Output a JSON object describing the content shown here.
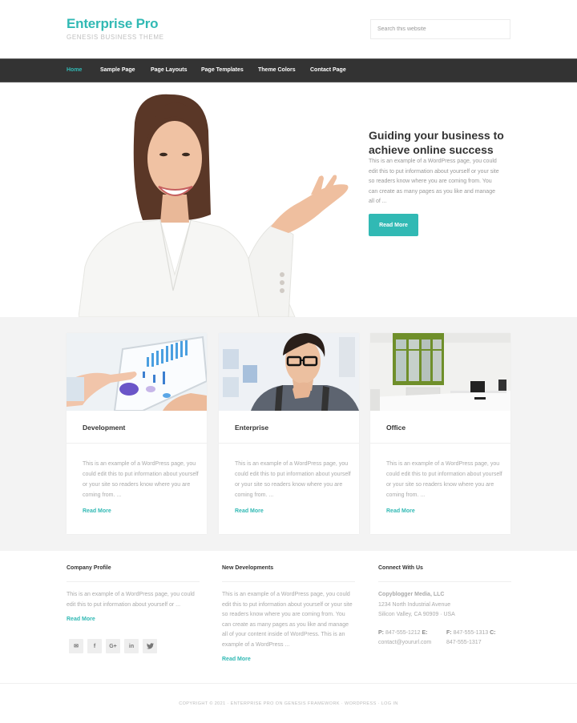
{
  "header": {
    "site_title": "Enterprise Pro",
    "site_description": "GENESIS BUSINESS THEME",
    "search_placeholder": "Search this website"
  },
  "nav": {
    "items": [
      {
        "label": "Home",
        "active": true
      },
      {
        "label": "Sample Page",
        "active": false
      },
      {
        "label": "Page Layouts",
        "active": false
      },
      {
        "label": "Page Templates",
        "active": false
      },
      {
        "label": "Theme Colors",
        "active": false
      },
      {
        "label": "Contact Page",
        "active": false
      }
    ]
  },
  "hero": {
    "image_alt": "Smiling businesswoman in white blazer presenting with open hand",
    "title": "Guiding your business to achieve online success",
    "text": "This is an example of a WordPress page, you could edit this to put information about yourself or your site so readers know where you are coming from. You can create as many pages as you like and manage all of ...",
    "button_label": "Read More"
  },
  "features": {
    "cards": [
      {
        "title": "Development",
        "image_alt": "Hand pointing at charts on a tablet",
        "text": "This is an example of a WordPress page, you could edit this to put information about yourself or your site so readers know where you are coming from. ...",
        "link_label": "Read More"
      },
      {
        "title": "Enterprise",
        "image_alt": "Man with glasses, hand on chin",
        "text": "This is an example of a WordPress page, you could edit this to put information about yourself or your site so readers know where you are coming from. ...",
        "link_label": "Read More"
      },
      {
        "title": "Office",
        "image_alt": "Bright office with green-framed windows and computers",
        "text": "This is an example of a WordPress page, you could edit this to put information about yourself or your site so readers know where you are coming from. ...",
        "link_label": "Read More"
      }
    ]
  },
  "widgets": {
    "company_profile": {
      "title": "Company Profile",
      "text": "This is an example of a WordPress page, you could edit this to put information about yourself or ...",
      "link_label": "Read More",
      "social": [
        {
          "icon": "envelope-icon",
          "glyph": "✉"
        },
        {
          "icon": "facebook-icon",
          "glyph": "f"
        },
        {
          "icon": "google-plus-icon",
          "glyph": "G+"
        },
        {
          "icon": "linkedin-icon",
          "glyph": "in"
        },
        {
          "icon": "twitter-icon",
          "glyph": "🐦"
        }
      ]
    },
    "new_developments": {
      "title": "New Developments",
      "text": "This is an example of a WordPress page, you could edit this to put information about yourself or your site so readers know where you are coming from. You can create as many pages as you like and manage all of your content inside of WordPress. This is an example of a WordPress ...",
      "link_label": "Read More"
    },
    "connect": {
      "title": "Connect With Us",
      "company": "Copyblogger Media, LLC",
      "address_line1": "1234 North Industrial Avenue",
      "address_line2": "Silicon Valley, CA 90909 · USA",
      "phone_label": "P:",
      "phone": "847-555-1212",
      "email_label": "E:",
      "email": "contact@yoururl.com",
      "fax_label": "F:",
      "fax": "847-555-1313",
      "cell_label": "C:",
      "cell": "847-555-1317"
    }
  },
  "footer": {
    "copyright": "COPYRIGHT © 2021 · ENTERPRISE PRO ON GENESIS FRAMEWORK · WORDPRESS · LOG IN"
  },
  "colors": {
    "accent": "#31b9b4",
    "nav_bg": "#333333",
    "features_bg": "#f3f3f3"
  }
}
